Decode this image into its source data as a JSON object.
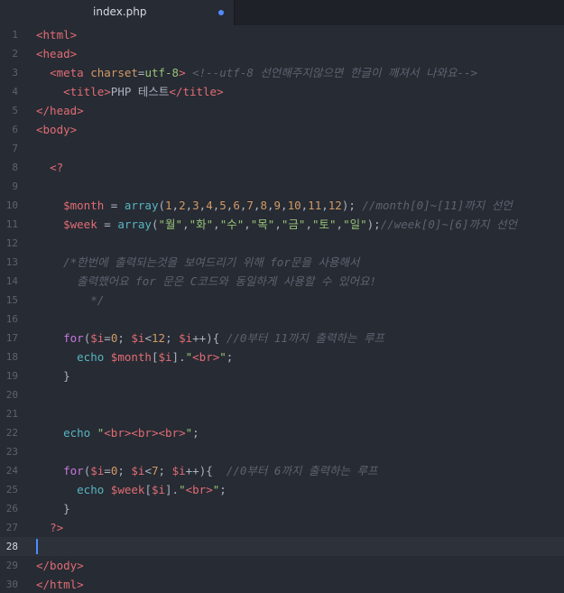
{
  "tab": {
    "filename": "index.php",
    "modified_indicator": "dot-icon"
  },
  "editor": {
    "active_line": 28,
    "lines": [
      {
        "n": "1",
        "tokens": [
          [
            "tag",
            "<html>"
          ]
        ]
      },
      {
        "n": "2",
        "tokens": [
          [
            "tag",
            "<head>"
          ]
        ]
      },
      {
        "n": "3",
        "tokens": [
          [
            "txt",
            "  "
          ],
          [
            "tag",
            "<meta"
          ],
          [
            "txt",
            " "
          ],
          [
            "attr",
            "charset"
          ],
          [
            "txt",
            "="
          ],
          [
            "str",
            "utf-8"
          ],
          [
            "tag",
            ">"
          ],
          [
            "txt",
            " "
          ],
          [
            "cm",
            "<!--utf-8 선언해주지않으면 한글이 깨져서 나와요-->"
          ]
        ]
      },
      {
        "n": "4",
        "tokens": [
          [
            "txt",
            "    "
          ],
          [
            "tag",
            "<title>"
          ],
          [
            "txt",
            "PHP 테스트"
          ],
          [
            "tag",
            "</title>"
          ]
        ]
      },
      {
        "n": "5",
        "tokens": [
          [
            "tag",
            "</head>"
          ]
        ]
      },
      {
        "n": "6",
        "tokens": [
          [
            "tag",
            "<body>"
          ]
        ]
      },
      {
        "n": "7",
        "tokens": []
      },
      {
        "n": "8",
        "tokens": [
          [
            "txt",
            "  "
          ],
          [
            "tag",
            "<?"
          ]
        ]
      },
      {
        "n": "9",
        "tokens": []
      },
      {
        "n": "10",
        "tokens": [
          [
            "txt",
            "    "
          ],
          [
            "var",
            "$month"
          ],
          [
            "txt",
            " = "
          ],
          [
            "fn",
            "array"
          ],
          [
            "txt",
            "("
          ],
          [
            "num",
            "1"
          ],
          [
            "txt",
            ","
          ],
          [
            "num",
            "2"
          ],
          [
            "txt",
            ","
          ],
          [
            "num",
            "3"
          ],
          [
            "txt",
            ","
          ],
          [
            "num",
            "4"
          ],
          [
            "txt",
            ","
          ],
          [
            "num",
            "5"
          ],
          [
            "txt",
            ","
          ],
          [
            "num",
            "6"
          ],
          [
            "txt",
            ","
          ],
          [
            "num",
            "7"
          ],
          [
            "txt",
            ","
          ],
          [
            "num",
            "8"
          ],
          [
            "txt",
            ","
          ],
          [
            "num",
            "9"
          ],
          [
            "txt",
            ","
          ],
          [
            "num",
            "10"
          ],
          [
            "txt",
            ","
          ],
          [
            "num",
            "11"
          ],
          [
            "txt",
            ","
          ],
          [
            "num",
            "12"
          ],
          [
            "txt",
            "); "
          ],
          [
            "cm",
            "//month[0]~[11]까지 선언"
          ]
        ]
      },
      {
        "n": "11",
        "tokens": [
          [
            "txt",
            "    "
          ],
          [
            "var",
            "$week"
          ],
          [
            "txt",
            " = "
          ],
          [
            "fn",
            "array"
          ],
          [
            "txt",
            "("
          ],
          [
            "str",
            "\"월\""
          ],
          [
            "txt",
            ","
          ],
          [
            "str",
            "\"화\""
          ],
          [
            "txt",
            ","
          ],
          [
            "str",
            "\"수\""
          ],
          [
            "txt",
            ","
          ],
          [
            "str",
            "\"목\""
          ],
          [
            "txt",
            ","
          ],
          [
            "str",
            "\"금\""
          ],
          [
            "txt",
            ","
          ],
          [
            "str",
            "\"토\""
          ],
          [
            "txt",
            ","
          ],
          [
            "str",
            "\"일\""
          ],
          [
            "txt",
            ");"
          ],
          [
            "cm",
            "//week[0]~[6]까지 선언"
          ]
        ]
      },
      {
        "n": "12",
        "tokens": []
      },
      {
        "n": "13",
        "tokens": [
          [
            "txt",
            "    "
          ],
          [
            "cm",
            "/*한번에 출력되는것을 보여드리기 위해 for문을 사용해서"
          ]
        ]
      },
      {
        "n": "14",
        "tokens": [
          [
            "txt",
            "      "
          ],
          [
            "cm",
            "출력했어요 for 문은 C코드와 동일하게 사용할 수 있어요!"
          ]
        ]
      },
      {
        "n": "15",
        "tokens": [
          [
            "txt",
            "        "
          ],
          [
            "cm",
            "*/"
          ]
        ]
      },
      {
        "n": "16",
        "tokens": []
      },
      {
        "n": "17",
        "tokens": [
          [
            "txt",
            "    "
          ],
          [
            "kw",
            "for"
          ],
          [
            "txt",
            "("
          ],
          [
            "var",
            "$i"
          ],
          [
            "txt",
            "="
          ],
          [
            "num",
            "0"
          ],
          [
            "txt",
            "; "
          ],
          [
            "var",
            "$i"
          ],
          [
            "txt",
            "<"
          ],
          [
            "num",
            "12"
          ],
          [
            "txt",
            "; "
          ],
          [
            "var",
            "$i"
          ],
          [
            "txt",
            "++){ "
          ],
          [
            "cm",
            "//0부터 11까지 출력하는 루프"
          ]
        ]
      },
      {
        "n": "18",
        "tokens": [
          [
            "txt",
            "      "
          ],
          [
            "fn",
            "echo"
          ],
          [
            "txt",
            " "
          ],
          [
            "var",
            "$month"
          ],
          [
            "txt",
            "["
          ],
          [
            "var",
            "$i"
          ],
          [
            "txt",
            "]."
          ],
          [
            "str",
            "\""
          ],
          [
            "tag",
            "<br>"
          ],
          [
            "str",
            "\""
          ],
          [
            "txt",
            ";"
          ]
        ]
      },
      {
        "n": "19",
        "tokens": [
          [
            "txt",
            "    }"
          ]
        ]
      },
      {
        "n": "20",
        "tokens": []
      },
      {
        "n": "21",
        "tokens": []
      },
      {
        "n": "22",
        "tokens": [
          [
            "txt",
            "    "
          ],
          [
            "fn",
            "echo"
          ],
          [
            "txt",
            " "
          ],
          [
            "str",
            "\""
          ],
          [
            "tag",
            "<br><br><br>"
          ],
          [
            "str",
            "\""
          ],
          [
            "txt",
            ";"
          ]
        ]
      },
      {
        "n": "23",
        "tokens": []
      },
      {
        "n": "24",
        "tokens": [
          [
            "txt",
            "    "
          ],
          [
            "kw",
            "for"
          ],
          [
            "txt",
            "("
          ],
          [
            "var",
            "$i"
          ],
          [
            "txt",
            "="
          ],
          [
            "num",
            "0"
          ],
          [
            "txt",
            "; "
          ],
          [
            "var",
            "$i"
          ],
          [
            "txt",
            "<"
          ],
          [
            "num",
            "7"
          ],
          [
            "txt",
            "; "
          ],
          [
            "var",
            "$i"
          ],
          [
            "txt",
            "++){  "
          ],
          [
            "cm",
            "//0부터 6까지 출력하는 루프"
          ]
        ]
      },
      {
        "n": "25",
        "tokens": [
          [
            "txt",
            "      "
          ],
          [
            "fn",
            "echo"
          ],
          [
            "txt",
            " "
          ],
          [
            "var",
            "$week"
          ],
          [
            "txt",
            "["
          ],
          [
            "var",
            "$i"
          ],
          [
            "txt",
            "]."
          ],
          [
            "str",
            "\""
          ],
          [
            "tag",
            "<br>"
          ],
          [
            "str",
            "\""
          ],
          [
            "txt",
            ";"
          ]
        ]
      },
      {
        "n": "26",
        "tokens": [
          [
            "txt",
            "    }"
          ]
        ]
      },
      {
        "n": "27",
        "tokens": [
          [
            "txt",
            "  "
          ],
          [
            "tag",
            "?>"
          ]
        ]
      },
      {
        "n": "28",
        "tokens": []
      },
      {
        "n": "29",
        "tokens": [
          [
            "tag",
            "</body>"
          ]
        ]
      },
      {
        "n": "30",
        "tokens": [
          [
            "tag",
            "</html>"
          ]
        ]
      }
    ]
  }
}
